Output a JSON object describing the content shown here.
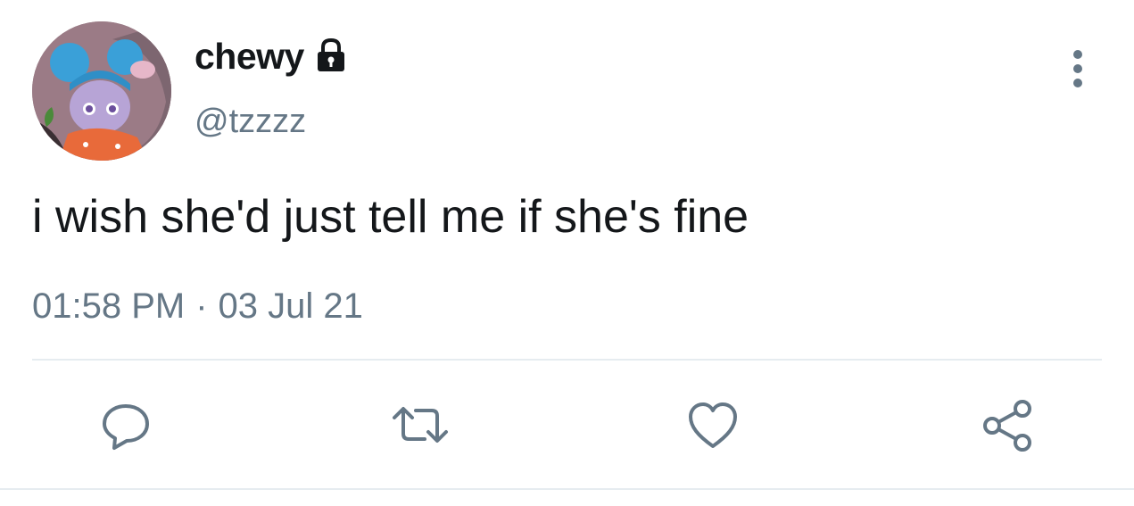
{
  "user": {
    "display_name": "chewy",
    "handle": "@tzzzz",
    "protected_icon": "lock-icon",
    "avatar": "avatar-image"
  },
  "tweet": {
    "text": "i wish she'd just tell me if she's fine",
    "time": "01:58 PM",
    "separator": "·",
    "date": "03 Jul 21"
  },
  "menu": {
    "icon": "more-vertical-icon"
  },
  "actions": [
    {
      "name": "reply",
      "icon": "reply-icon"
    },
    {
      "name": "retweet",
      "icon": "retweet-icon"
    },
    {
      "name": "like",
      "icon": "heart-icon"
    },
    {
      "name": "share",
      "icon": "share-icon"
    }
  ],
  "colors": {
    "primary_text": "#14171a",
    "secondary_text": "#657786",
    "divider": "#e6ecf0",
    "icon": "#657786"
  }
}
